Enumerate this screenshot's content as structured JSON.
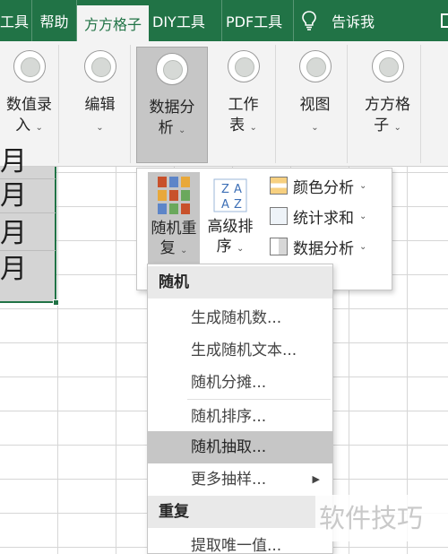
{
  "tabs": [
    {
      "label": "工具",
      "active": false
    },
    {
      "label": "帮助",
      "active": false
    },
    {
      "label": "方方格子",
      "active": true
    },
    {
      "label": "DIY工具",
      "active": false
    },
    {
      "label": "PDF工具",
      "active": false
    }
  ],
  "tell_me": "告诉我",
  "ribbon": {
    "groups": [
      {
        "line1": "数值录",
        "line2": "入",
        "icon": "circle-placeholder-icon"
      },
      {
        "line1": "编辑",
        "line2": "",
        "icon": "circle-placeholder-icon"
      },
      {
        "line1": "数据分",
        "line2": "析",
        "icon": "circle-placeholder-icon"
      },
      {
        "line1": "工作",
        "line2": "表",
        "icon": "circle-placeholder-icon"
      },
      {
        "line1": "视图",
        "line2": "",
        "icon": "circle-placeholder-icon"
      },
      {
        "line1": "方方格",
        "line2": "子",
        "icon": "circle-placeholder-icon"
      }
    ]
  },
  "sheet": {
    "cells": [
      "月",
      "月",
      "月",
      "月"
    ]
  },
  "gallery": {
    "random_repeat": {
      "line1": "随机重",
      "line2": "复"
    },
    "advanced_sort": {
      "line1": "高级排",
      "line2": "序"
    },
    "commands": [
      {
        "label": "颜色分析",
        "icon": "color-analysis-icon"
      },
      {
        "label": "统计求和",
        "icon": "sum-stats-icon"
      },
      {
        "label": "数据分析",
        "icon": "data-analysis-icon"
      }
    ]
  },
  "menu": {
    "section_random": "随机",
    "random_items": [
      "生成随机数...",
      "生成随机文本...",
      "随机分摊...",
      "随机排序...",
      "随机抽取...",
      "更多抽样..."
    ],
    "hot_index": 4,
    "section_repeat": "重复",
    "repeat_items": [
      "提取唯一值..."
    ]
  },
  "watermark": "软件技巧",
  "colors": {
    "accent": "#217346",
    "ribbon": "#f3f3f3",
    "pressed": "#c6c6c6"
  }
}
